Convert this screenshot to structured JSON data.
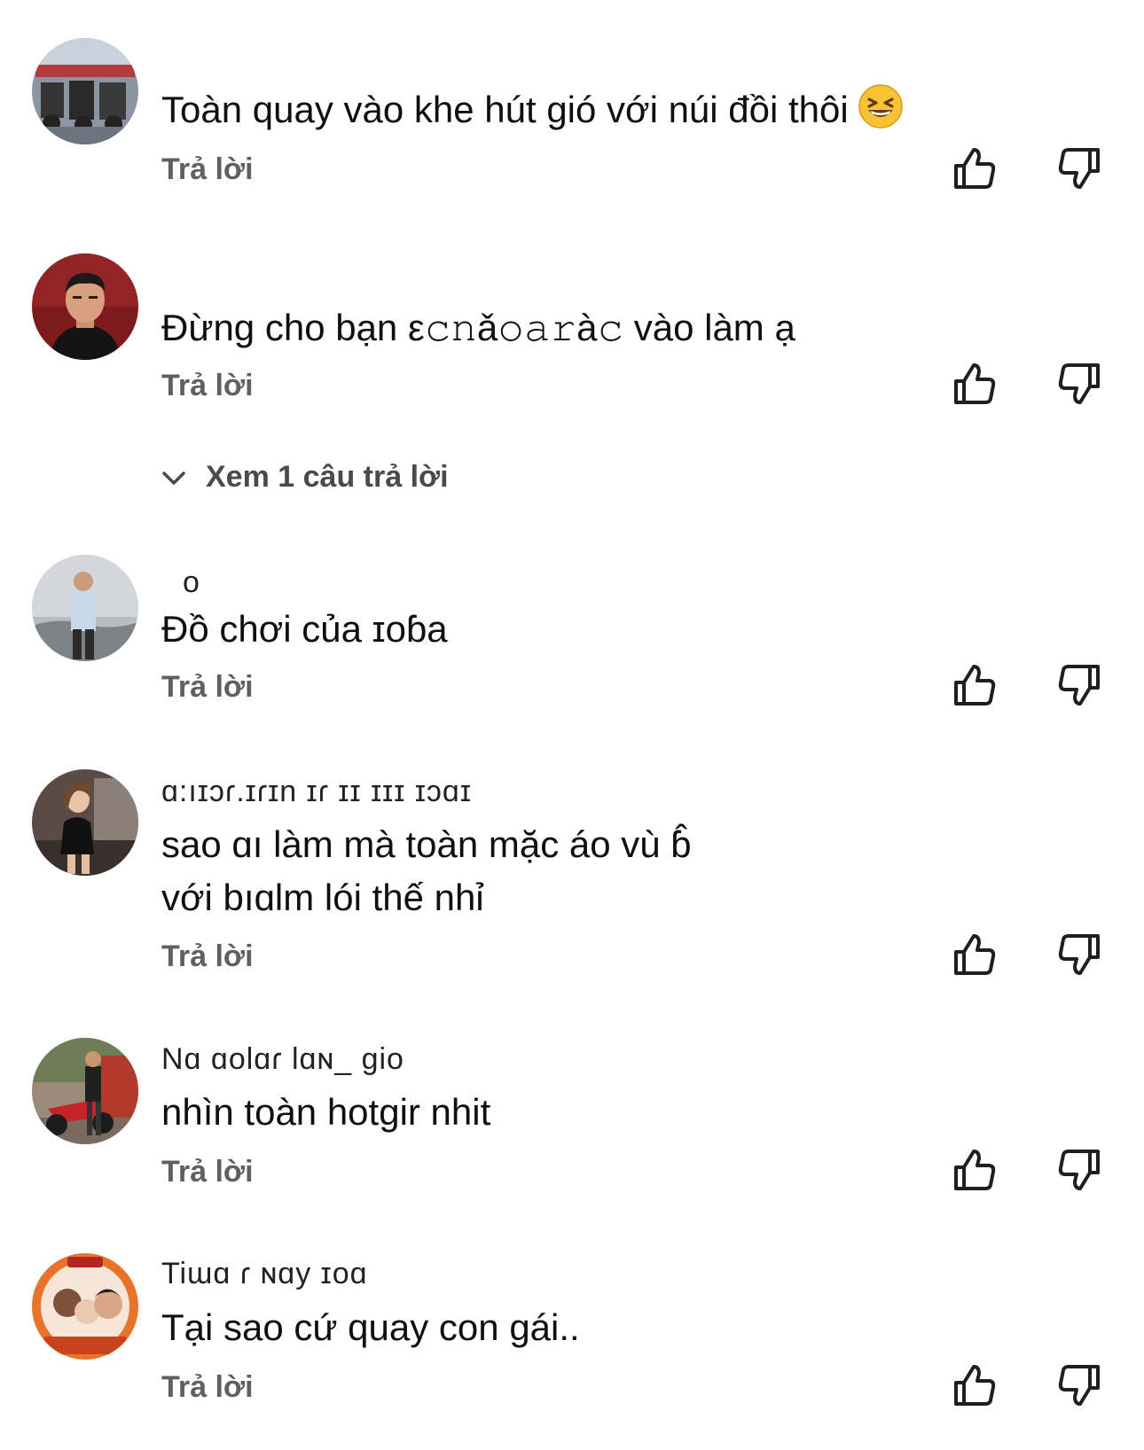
{
  "reply_label": "Trả lời",
  "view_replies_label": "Xem 1 câu trả lời",
  "icons": {
    "like": "thumbs-up-icon",
    "dislike": "thumbs-down-icon",
    "expand": "chevron-down-icon",
    "emoji": "grinning-squinting-face-emoji"
  },
  "comments": [
    {
      "author": "",
      "text": "Toàn quay vào khe hút gió với núi đồi thôi",
      "emoji": "😆"
    },
    {
      "author": "",
      "text": "Đừng cho bạn ε𝚌𝚗ǎ𝚘𝚊𝚛à𝚌  vào làm ạ"
    },
    {
      "author": "o",
      "text": "Đồ chơi của ɪoɓa"
    },
    {
      "author": "ɑ:ıɪɔɾ.ɪɾɪn  ɪɾ  ɪɪ  ɪɪɪ ɪɔɑɪ",
      "text": "sao ɑı làm mà toàn mặc áo vù ɓ̂\nvới bıɑlm lói thế nhỉ"
    },
    {
      "author": "Nɑ   ɑolɑɾ lɑɴ_ gio",
      "text": "nhìn toàn hotgir nhit"
    },
    {
      "author": "Tiɯɑ ɾ ɴɑy   ɪoɑ",
      "text": "Tại sao cứ quay con gái.."
    }
  ]
}
